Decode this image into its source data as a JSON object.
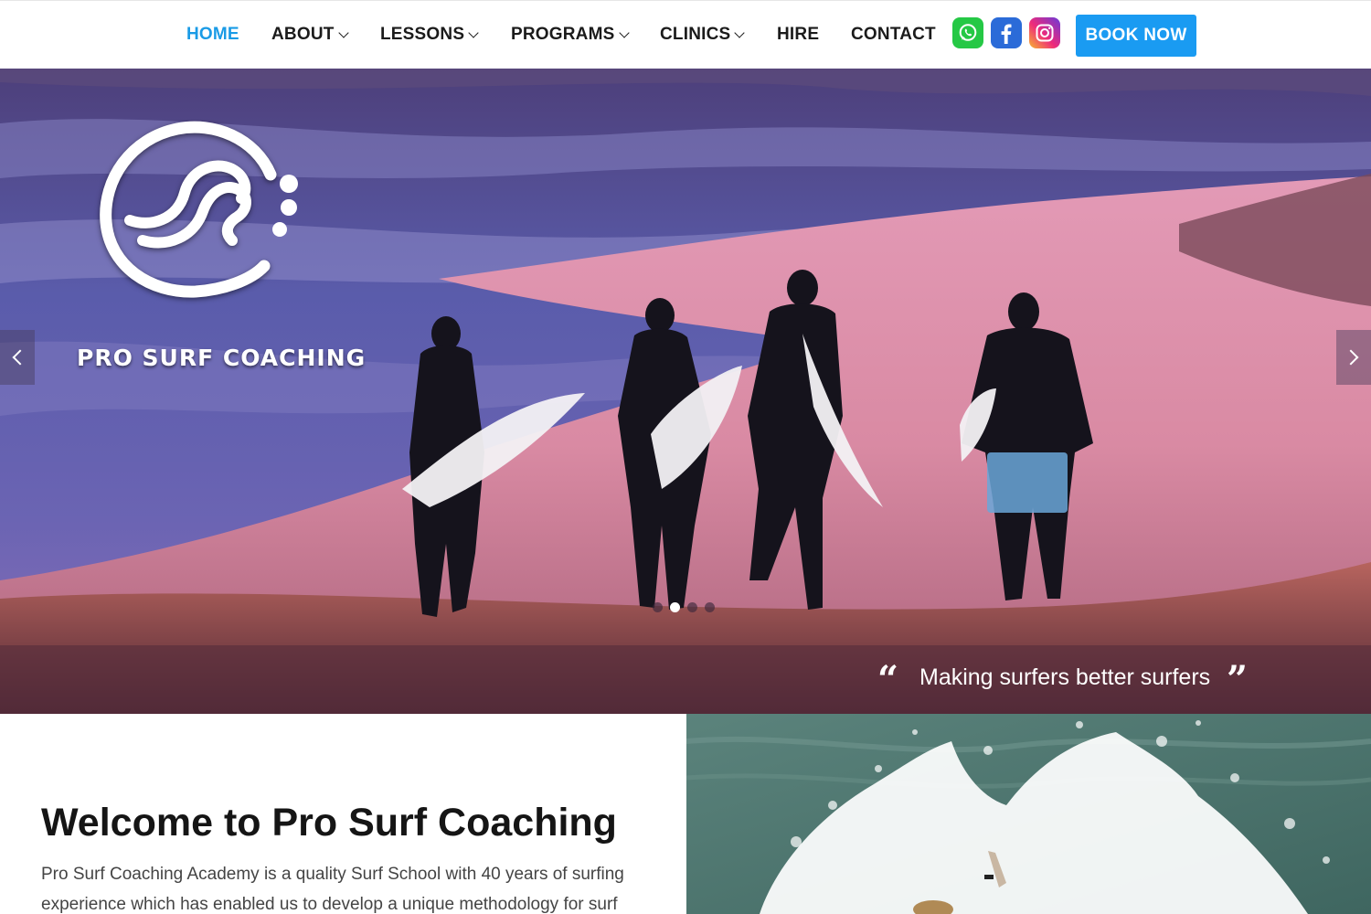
{
  "nav": {
    "items": [
      {
        "label": "HOME",
        "active": true,
        "dropdown": false
      },
      {
        "label": "ABOUT",
        "active": false,
        "dropdown": true
      },
      {
        "label": "LESSONS",
        "active": false,
        "dropdown": true
      },
      {
        "label": "PROGRAMS",
        "active": false,
        "dropdown": true
      },
      {
        "label": "CLINICS",
        "active": false,
        "dropdown": true
      },
      {
        "label": "HIRE",
        "active": false,
        "dropdown": false
      },
      {
        "label": "CONTACT",
        "active": false,
        "dropdown": false
      }
    ],
    "social": [
      {
        "icon": "whatsapp-icon",
        "color": "#25c845"
      },
      {
        "icon": "facebook-icon",
        "color": "#2b6bd8"
      },
      {
        "icon": "instagram-icon",
        "color": "#ee2a7b"
      }
    ],
    "book_label": "BOOK NOW",
    "accent": "#1a9bf2"
  },
  "hero": {
    "brand": "PRO SURF COACHING",
    "quote": "Making surfers better surfers",
    "slides": 4,
    "active_slide": 2
  },
  "welcome": {
    "title": "Welcome to Pro Surf Coaching",
    "body": "Pro Surf Coaching Academy is a quality Surf School with 40 years of surfing experience which has enabled us to develop a unique methodology for surf"
  }
}
